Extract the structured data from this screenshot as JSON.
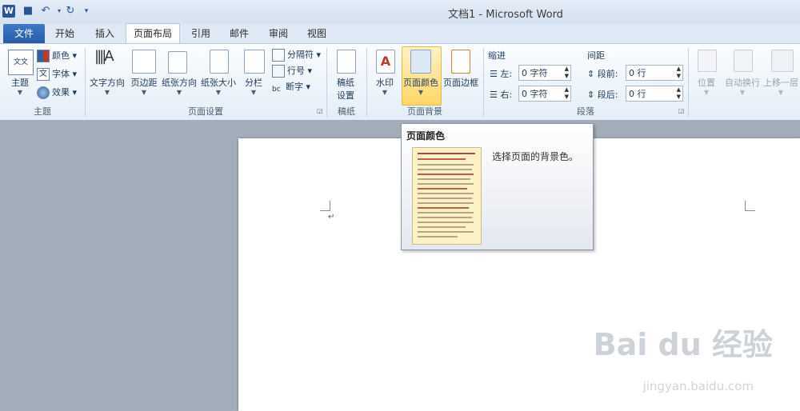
{
  "window": {
    "title": "文档1 - Microsoft Word",
    "app_icon": "W"
  },
  "tabs": {
    "file": "文件",
    "items": [
      "开始",
      "插入",
      "页面布局",
      "引用",
      "邮件",
      "审阅",
      "视图"
    ],
    "active": "页面布局"
  },
  "ribbon": {
    "theme_group": {
      "label": "主题",
      "theme": "主题",
      "colors": "颜色",
      "fonts": "字体",
      "effects": "效果",
      "theme_icon_text": "文文"
    },
    "page_setup": {
      "label": "页面设置",
      "text_dir": "文字方向",
      "margins": "页边距",
      "orientation": "纸张方向",
      "size": "纸张大小",
      "columns": "分栏",
      "breaks": "分隔符",
      "line_numbers": "行号",
      "hyphenation": "断字"
    },
    "manuscript": {
      "label": "稿纸",
      "setup_line1": "稿纸",
      "setup_line2": "设置"
    },
    "page_background": {
      "label": "页面背景",
      "watermark": "水印",
      "page_color": "页面颜色",
      "page_borders": "页面边框"
    },
    "paragraph": {
      "label": "段落",
      "indent": "缩进",
      "spacing": "间距",
      "left": "左:",
      "right": "右:",
      "before": "段前:",
      "after": "段后:",
      "left_value": "0 字符",
      "right_value": "0 字符",
      "before_value": "0 行",
      "after_value": "0 行"
    },
    "arrange": {
      "position": "位置",
      "wrap": "自动换行",
      "bring_forward": "上移一层"
    }
  },
  "tooltip": {
    "title": "页面颜色",
    "description": "选择页面的背景色。"
  },
  "document": {
    "para_mark": "↵"
  },
  "watermark": {
    "main": "Bai du 经验",
    "sub": "jingyan.baidu.com"
  }
}
